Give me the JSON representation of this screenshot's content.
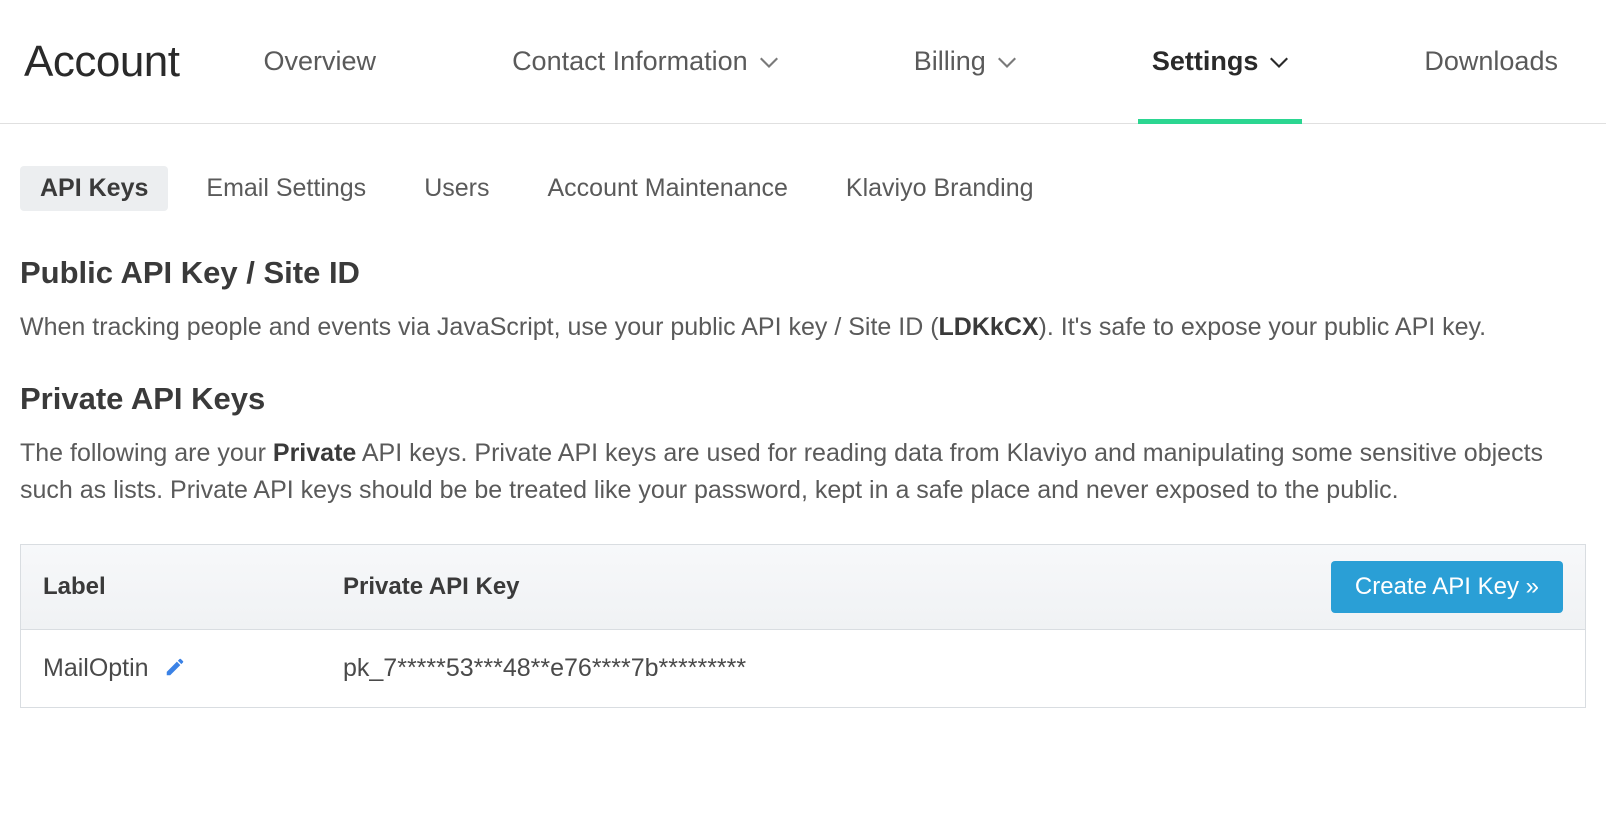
{
  "page_title": "Account",
  "nav": {
    "items": [
      {
        "label": "Overview",
        "has_caret": false,
        "active": false
      },
      {
        "label": "Contact Information",
        "has_caret": true,
        "active": false
      },
      {
        "label": "Billing",
        "has_caret": true,
        "active": false
      },
      {
        "label": "Settings",
        "has_caret": true,
        "active": true
      },
      {
        "label": "Downloads",
        "has_caret": false,
        "active": false
      }
    ]
  },
  "subtabs": [
    {
      "label": "API Keys",
      "active": true
    },
    {
      "label": "Email Settings",
      "active": false
    },
    {
      "label": "Users",
      "active": false
    },
    {
      "label": "Account Maintenance",
      "active": false
    },
    {
      "label": "Klaviyo Branding",
      "active": false
    }
  ],
  "public_section": {
    "title": "Public API Key / Site ID",
    "desc_pre": "When tracking people and events via JavaScript, use your public API key / Site ID (",
    "site_id": "LDKkCX",
    "desc_post": "). It's safe to expose your public API key."
  },
  "private_section": {
    "title": "Private API Keys",
    "desc_pre": "The following are your ",
    "desc_bold": "Private",
    "desc_post": " API keys. Private API keys are used for reading data from Klaviyo and manipulating some sensitive objects such as lists. Private API keys should be be treated like your password, kept in a safe place and never exposed to the public."
  },
  "table": {
    "columns": {
      "label": "Label",
      "key": "Private API Key"
    },
    "create_button": "Create API Key »",
    "rows": [
      {
        "label": "MailOptin",
        "key": "pk_7*****53***48**e76****7b*********"
      }
    ]
  },
  "colors": {
    "accent_green": "#2bd691",
    "accent_blue": "#2a9fd6",
    "icon_blue": "#3b82e6"
  }
}
